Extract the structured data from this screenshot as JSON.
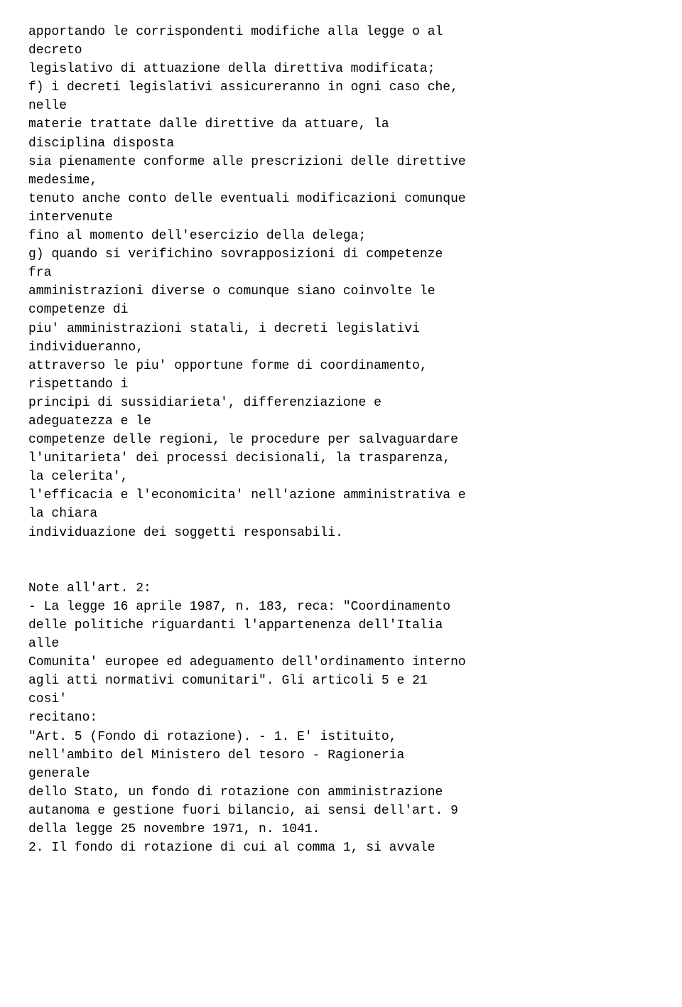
{
  "content": {
    "main_text": "apportando le corrispondenti modifiche alla legge o al\ndecreto\nlegislativo di attuazione della direttiva modificata;\nf) i decreti legislativi assicureranno in ogni caso che,\nnelle\nmaterie trattate dalle direttive da attuare, la\ndisciplina disposta\nsia pienamente conforme alle prescrizioni delle direttive\nmedesime,\ntenuto anche conto delle eventuali modificazioni comunque\nintervenute\nfino al momento dell'esercizio della delega;\ng) quando si verifichino sovrapposizioni di competenze\nfra\namministrazioni diverse o comunque siano coinvolte le\ncompetenze di\npiu' amministrazioni statali, i decreti legislativi\nindividueranno,\nattraverso le piu' opportune forme di coordinamento,\nrispettando i\nprincipi di sussidiarieta', differenziazione e\nadeguatezza e le\ncompetenze delle regioni, le procedure per salvaguardare\nl'unitarieta' dei processi decisionali, la trasparenza,\nla celerita',\nl'efficacia e l'economicita' nell'azione amministrativa e\nla chiara\nindividuazione dei soggetti responsabili.\n\n\nNote all'art. 2:\n- La legge 16 aprile 1987, n. 183, reca: \"Coordinamento\ndelle politiche riguardanti l'appartenenza dell'Italia\nalle\nComunita' europee ed adeguamento dell'ordinamento interno\nagli atti normativi comunitari\". Gli articoli 5 e 21\ncosi'\nrecitano:\n\"Art. 5 (Fondo di rotazione). - 1. E' istituito,\nnell'ambito del Ministero del tesoro - Ragioneria\ngenerale\ndello Stato, un fondo di rotazione con amministrazione\nautanoma e gestione fuori bilancio, ai sensi dell'art. 9\ndella legge 25 novembre 1971, n. 1041.\n2. Il fondo di rotazione di cui al comma 1, si avvale"
  }
}
